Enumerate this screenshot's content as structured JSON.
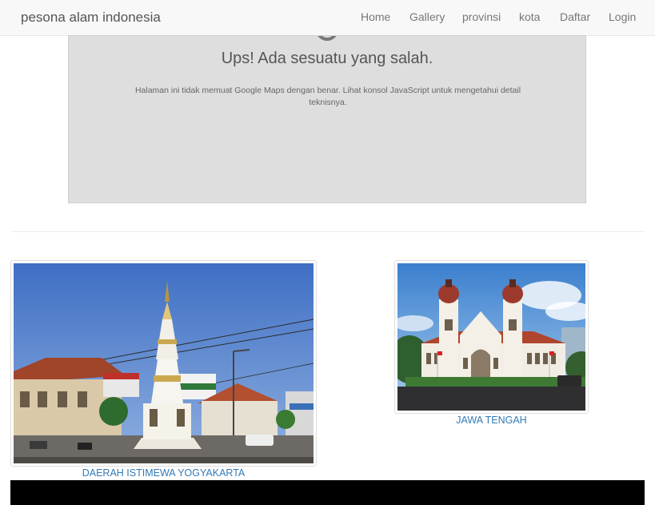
{
  "navbar": {
    "brand": "pesona alam indonesia",
    "links": [
      {
        "label": "Home"
      },
      {
        "label": "Gallery"
      },
      {
        "label": "provinsi"
      },
      {
        "label": "kota"
      },
      {
        "label": "Daftar"
      },
      {
        "label": "Login"
      }
    ]
  },
  "map": {
    "error_title": "Ups! Ada sesuatu yang salah.",
    "error_message": "Halaman ini tidak memuat Google Maps dengan benar. Lihat konsol JavaScript untuk mengetahui detail teknisnya."
  },
  "gallery": {
    "items": [
      {
        "caption": "DAERAH ISTIMEWA YOGYAKARTA",
        "image": "tugu-yogyakarta-photo"
      },
      {
        "caption": "JAWA TENGAH",
        "image": "lawang-sewu-photo"
      }
    ]
  },
  "colors": {
    "link": "#337ab7",
    "navbar_bg": "#f8f8f8",
    "map_bg": "#dedede"
  }
}
